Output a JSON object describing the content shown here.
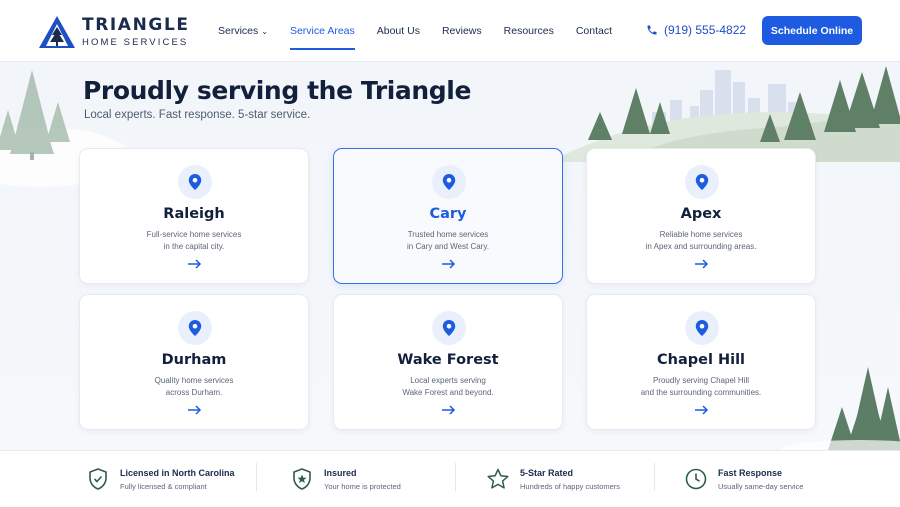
{
  "brand": {
    "name": "TRIANGLE",
    "tagline": "HOME SERVICES",
    "logo_icon": "triangle-trees-logo"
  },
  "nav": {
    "items": [
      {
        "label": "Services",
        "has_dropdown": true,
        "active": false
      },
      {
        "label": "Service Areas",
        "active": true
      },
      {
        "label": "About Us",
        "active": false
      },
      {
        "label": "Reviews",
        "active": false
      },
      {
        "label": "Resources",
        "active": false
      },
      {
        "label": "Contact",
        "active": false
      }
    ]
  },
  "header": {
    "phone": "(919) 555-4822",
    "phone_icon": "phone-icon",
    "cta_label": "Schedule Online"
  },
  "hero": {
    "title": "Proudly serving the Triangle",
    "subtitle": "Local experts. Fast response. 5-star service."
  },
  "areas": [
    {
      "name": "Raleigh",
      "line1": "Full-service home services",
      "line2": "in the capital city.",
      "selected": false
    },
    {
      "name": "Cary",
      "line1": "Trusted home services",
      "line2": "in Cary and West Cary.",
      "selected": true
    },
    {
      "name": "Apex",
      "line1": "Reliable home services",
      "line2": "in Apex and surrounding areas.",
      "selected": false
    },
    {
      "name": "Durham",
      "line1": "Quality home services",
      "line2": "across Durham.",
      "selected": false
    },
    {
      "name": "Wake Forest",
      "line1": "Local experts serving",
      "line2": "Wake Forest and beyond.",
      "selected": false
    },
    {
      "name": "Chapel Hill",
      "line1": "Proudly serving Chapel Hill",
      "line2": "and the surrounding communities.",
      "selected": false
    }
  ],
  "trust": [
    {
      "title": "Licensed in North Carolina",
      "sub": "Fully licensed & compliant",
      "icon": "shield-check-icon"
    },
    {
      "title": "Insured",
      "sub": "Your home is protected",
      "icon": "shield-star-icon"
    },
    {
      "title": "5-Star Rated",
      "sub": "Hundreds of happy customers",
      "icon": "star-icon"
    },
    {
      "title": "Fast Response",
      "sub": "Usually same-day service",
      "icon": "clock-icon"
    }
  ],
  "colors": {
    "accent": "#1d5ce0",
    "navy": "#1a2b4c",
    "trust_icon": "#2e5e46",
    "background": "#f4f6f9"
  }
}
